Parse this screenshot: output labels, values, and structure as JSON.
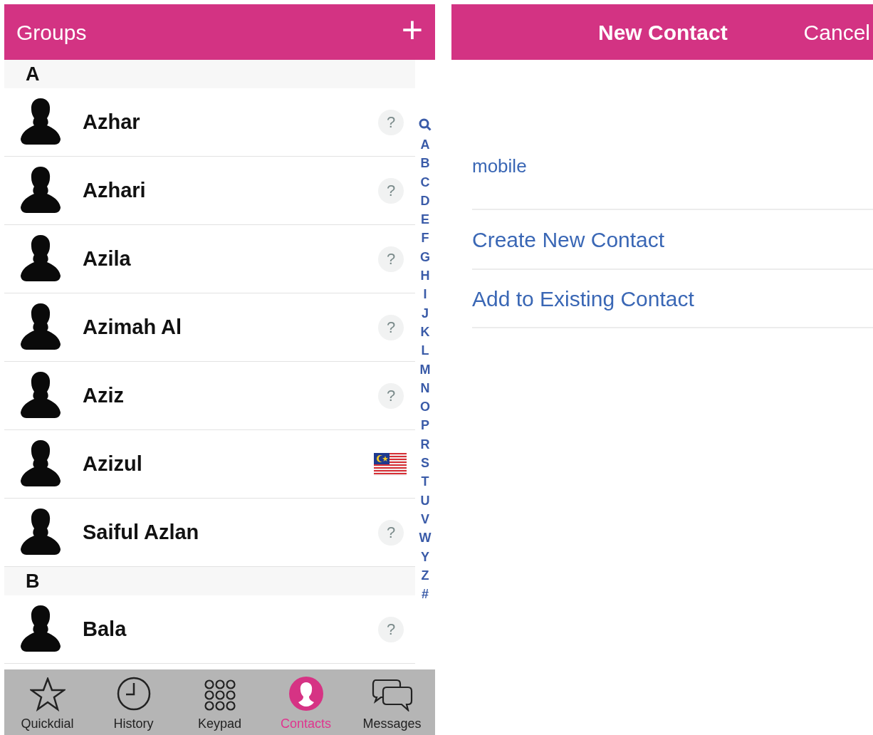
{
  "contacts_panel": {
    "title": "Groups",
    "add_button": "+",
    "sections": [
      {
        "letter": "A",
        "contacts": [
          {
            "name": "Azhar",
            "kind": "unknown",
            "badge": "?"
          },
          {
            "name": "Azhari",
            "kind": "unknown",
            "badge": "?"
          },
          {
            "name": "Azila",
            "kind": "unknown",
            "badge": "?"
          },
          {
            "name": "Azimah Al",
            "kind": "unknown",
            "badge": "?"
          },
          {
            "name": "Aziz",
            "kind": "unknown",
            "badge": "?"
          },
          {
            "name": "Azizul",
            "kind": "flag"
          },
          {
            "name": "Saiful Azlan",
            "kind": "unknown",
            "badge": "?"
          }
        ]
      },
      {
        "letter": "B",
        "contacts": [
          {
            "name": "Bala",
            "kind": "unknown",
            "badge": "?"
          }
        ]
      }
    ],
    "index": [
      "A",
      "B",
      "C",
      "D",
      "E",
      "F",
      "G",
      "H",
      "I",
      "J",
      "K",
      "L",
      "M",
      "N",
      "O",
      "P",
      "R",
      "S",
      "T",
      "U",
      "V",
      "W",
      "Y",
      "Z",
      "#"
    ],
    "tabs": [
      {
        "label": "Quickdial",
        "selected": false
      },
      {
        "label": "History",
        "selected": false
      },
      {
        "label": "Keypad",
        "selected": false
      },
      {
        "label": "Contacts",
        "selected": true
      },
      {
        "label": "Messages",
        "selected": false
      }
    ]
  },
  "new_contact_panel": {
    "title": "New Contact",
    "cancel": "Cancel",
    "field_label": "mobile",
    "actions": [
      "Create New Contact",
      "Add to Existing Contact"
    ]
  }
}
